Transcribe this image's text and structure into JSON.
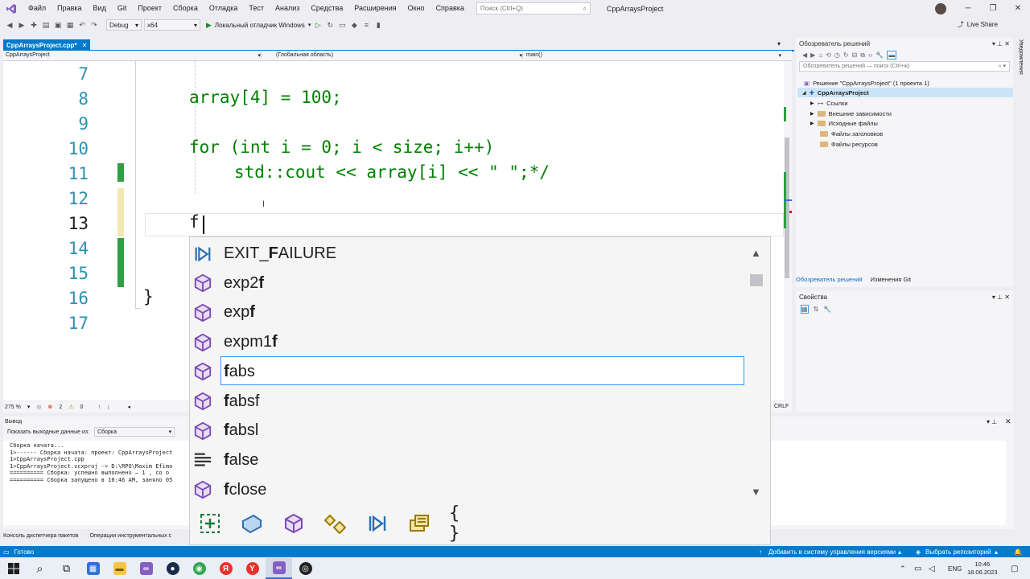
{
  "menu": {
    "items": [
      "Файл",
      "Правка",
      "Вид",
      "Git",
      "Проект",
      "Сборка",
      "Отладка",
      "Тест",
      "Анализ",
      "Средства",
      "Расширения",
      "Окно",
      "Справка"
    ],
    "search_placeholder": "Поиск (Ctrl+Q)",
    "project_title": "CppArraysProject"
  },
  "toolbar": {
    "config": "Debug",
    "platform": "x64",
    "run_label": "Локальный отладчик Windows",
    "live_share": "Live Share"
  },
  "editor": {
    "tab_label": "CppArraysProject.cpp*",
    "nav_project": "CppArraysProject",
    "nav_scope": "(Глобальная область)",
    "nav_member": "main()",
    "line_numbers": [
      "7",
      "8",
      "9",
      "10",
      "11",
      "12",
      "13",
      "14",
      "15",
      "16",
      "17"
    ],
    "code": {
      "l8": "array[4] = 100;",
      "l10": "for (int i = 0; i < size; i++)",
      "l11": "std::cout << array[i] << \" \";*/",
      "l13": "f",
      "l16": "}"
    },
    "zoom": "275 %",
    "errors": "2",
    "warnings": "0",
    "line_ending": "CRLF"
  },
  "autocomplete": {
    "items": [
      {
        "pre": "EXIT_",
        "bold": "F",
        "post": "AILURE",
        "icon": "macro-icon"
      },
      {
        "pre": "exp2",
        "bold": "f",
        "post": "",
        "icon": "function-icon"
      },
      {
        "pre": "exp",
        "bold": "f",
        "post": "",
        "icon": "function-icon"
      },
      {
        "pre": "expm1",
        "bold": "f",
        "post": "",
        "icon": "function-icon"
      },
      {
        "pre": "",
        "bold": "f",
        "post": "abs",
        "icon": "function-icon"
      },
      {
        "pre": "",
        "bold": "f",
        "post": "absf",
        "icon": "function-icon"
      },
      {
        "pre": "",
        "bold": "f",
        "post": "absl",
        "icon": "function-icon"
      },
      {
        "pre": "",
        "bold": "f",
        "post": "alse",
        "icon": "keyword-icon"
      },
      {
        "pre": "",
        "bold": "f",
        "post": "close",
        "icon": "function-icon"
      }
    ],
    "selected_index": 4,
    "filters": [
      "+",
      "▣",
      "◇",
      "⚙",
      "▷",
      "▤",
      "{ }"
    ]
  },
  "output": {
    "title": "Вывод",
    "show_label": "Показать выходные данные из:",
    "source": "Сборка",
    "lines": [
      "Сборка начата...",
      "1>------ Сборка начата: проект: CppArraysProject",
      "1>CppArraysProject.cpp",
      "1>CppArraysProject.vcxproj -> D:\\RPO\\Maxim Efimo",
      "========== Сборка: успешно выполнено — 1 , со о",
      "========== Сборка запущено в 10:46 AM, заняло 05"
    ],
    "bottom_tabs": [
      "Консоль диспетчера пакетов",
      "Операции инструментальных с"
    ]
  },
  "solution": {
    "title": "Обозреватель решений",
    "search": "Обозреватель решений — поиск (Ctrl+ж)",
    "root": "Решение \"CppArraysProject\" (1 проекта 1)",
    "project": "CppArraysProject",
    "nodes": [
      "Ссылки",
      "Внешние зависимости",
      "Исходные файлы",
      "Файлы заголовков",
      "Файлы ресурсов"
    ],
    "tabs": [
      "Обозреватель решений",
      "Изменения Git"
    ],
    "properties_title": "Свойства",
    "side_label": "Уведомления"
  },
  "status": {
    "ready": "Готово",
    "add_vcs": "Добавить в систему управления версиями",
    "select_repo": "Выбрать репозиторий"
  },
  "taskbar": {
    "lang": "ENG",
    "time": "10:46",
    "date": "18.06.2023"
  }
}
